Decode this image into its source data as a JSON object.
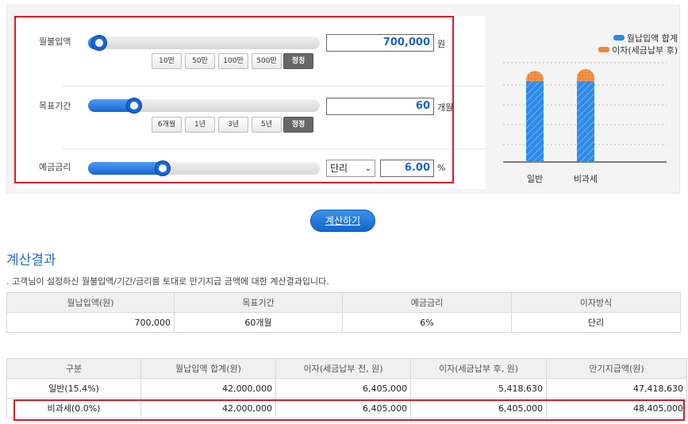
{
  "inputs": {
    "monthly_deposit": {
      "label": "월불입액",
      "value": "700,000",
      "unit": "원",
      "slider_fraction": 0.02,
      "quick_buttons": [
        "10만",
        "50만",
        "100만",
        "500만",
        "정정"
      ]
    },
    "target_period": {
      "label": "목표기간",
      "value": "60",
      "unit": "개월",
      "slider_fraction": 0.18,
      "quick_buttons": [
        "6개월",
        "1년",
        "3년",
        "5년",
        "정정"
      ]
    },
    "interest_rate": {
      "label": "예금금리",
      "interest_type": "단리",
      "value": "6.00",
      "unit": "%",
      "slider_fraction": 0.31
    }
  },
  "chart_data": {
    "type": "bar",
    "stacked": true,
    "categories": [
      "일반",
      "비과세"
    ],
    "series": [
      {
        "name": "월납입액 합계",
        "values": [
          42000000,
          42000000
        ],
        "color": "#2d8ae6"
      },
      {
        "name": "이자(세금납부 후)",
        "values": [
          5418630,
          6405000
        ],
        "color": "#f0863a"
      }
    ],
    "grid": true,
    "legend": "top-right",
    "y_axis_labels": false
  },
  "calc_button": {
    "label": "계산하기"
  },
  "result": {
    "title": "계산결과",
    "description": ". 고객님이 설정하신 월불입액/기간/금리를 토대로 만기지급 금액에 대한 계산결과입니다.",
    "summary_table": {
      "headers": [
        "월납입액(원)",
        "목표기간",
        "예금금리",
        "이자방식"
      ],
      "row": [
        "700,000",
        "60개월",
        "6%",
        "단리"
      ]
    },
    "detail_table": {
      "headers": [
        "구분",
        "월납입액 합계(원)",
        "이자(세금납부 전, 원)",
        "이자(세금납부 후, 원)",
        "만기지급액(원)"
      ],
      "rows": [
        [
          "일반(15.4%)",
          "42,000,000",
          "6,405,000",
          "5,418,630",
          "47,418,630"
        ],
        [
          "비과세(0.0%)",
          "42,000,000",
          "6,405,000",
          "6,405,000",
          "48,405,000"
        ]
      ]
    }
  },
  "colors": {
    "accent_blue": "#1e63c4",
    "highlight_red": "#d81b2a",
    "bar_blue": "#2d8ae6",
    "bar_orange": "#f0863a"
  }
}
